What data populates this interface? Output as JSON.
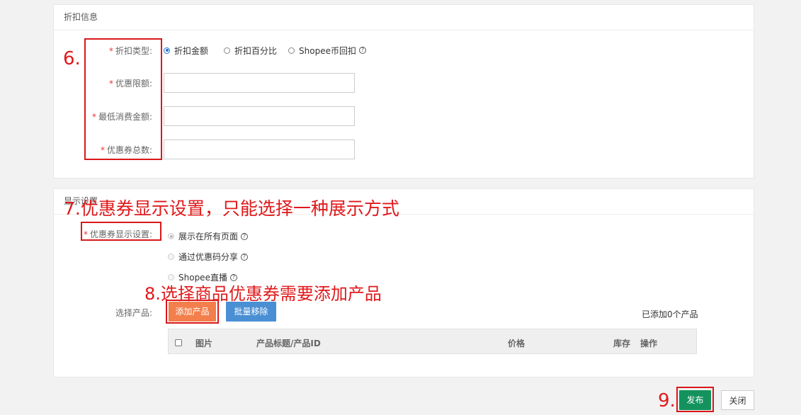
{
  "discount_section": {
    "title": "折扣信息",
    "type_label": "折扣类型:",
    "type_options": [
      "折扣金额",
      "折扣百分比",
      "Shopee币回扣"
    ],
    "limit_label": "优惠限额:",
    "min_spend_label": "最低消费金额:",
    "total_label": "优惠券总数:",
    "required_mark": "*"
  },
  "display_section": {
    "title": "显示设置",
    "display_label": "优惠券显示设置:",
    "options": [
      "展示在所有页面",
      "通过优惠码分享",
      "Shopee直播"
    ],
    "product_label": "选择产品:",
    "add_product_button": "添加产品",
    "batch_remove_button": "批量移除",
    "added_count": "已添加0个产品",
    "table_headers": [
      "图片",
      "产品标题/产品ID",
      "价格",
      "库存",
      "操作"
    ]
  },
  "footer": {
    "publish_button": "发布",
    "close_button": "关闭"
  },
  "annotations": {
    "step6": "6.",
    "step7": "7.优惠券显示设置，只能选择一种展示方式",
    "step8": "8.选择商品优惠券需要添加产品",
    "step9": "9."
  },
  "colors": {
    "annotation_red": "#d9181a",
    "add_button": "#f37f4c",
    "batch_button": "#4a8fd3",
    "publish_button": "#14925d",
    "radio_blue": "#1e73d8"
  }
}
